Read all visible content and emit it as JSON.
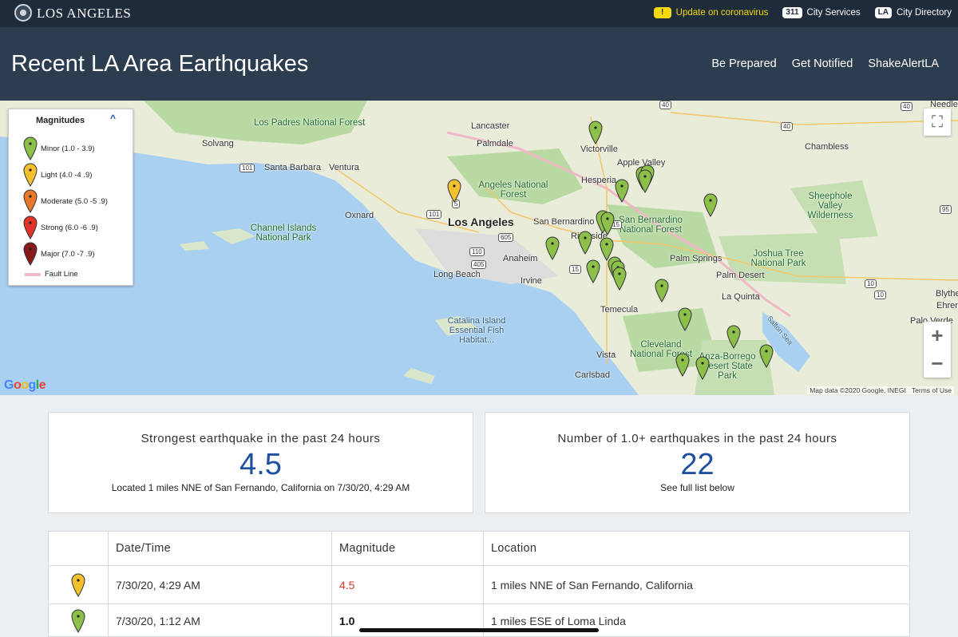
{
  "topbar": {
    "brand": "LOS ANGELES",
    "alert_badge": "!",
    "alert_text": "Update on coronavirus",
    "services_badge": "311",
    "services_label": "City Services",
    "directory_badge": "LA",
    "directory_label": "City Directory"
  },
  "header": {
    "title": "Recent LA Area Earthquakes",
    "nav": [
      "Be Prepared",
      "Get Notified",
      "ShakeAlertLA"
    ]
  },
  "map": {
    "legend": {
      "title": "Magnitudes",
      "toggle": "^",
      "items": [
        {
          "label": "Minor (1.0 - 3.9)",
          "color": "#8dc04a"
        },
        {
          "label": "Light (4.0 -4 .9)",
          "color": "#f3c12e"
        },
        {
          "label": "Moderate (5.0 -5 .9)",
          "color": "#e8782a"
        },
        {
          "label": "Strong (6.0 -6 .9)",
          "color": "#e0342a"
        },
        {
          "label": "Major (7.0 -7 .9)",
          "color": "#8a1a1a"
        }
      ],
      "fault_label": "Fault Line"
    },
    "places": [
      "Los Padres National Forest",
      "Lancaster",
      "Palmdale",
      "Victorville",
      "Apple Valley",
      "Hesperia",
      "Solvang",
      "Santa Barbara",
      "Ventura",
      "Oxnard",
      "Angeles National Forest",
      "Los Angeles",
      "San Bernardino",
      "Riverside",
      "San Bernardino National Forest",
      "Sheephole Valley Wilderness",
      "Channel Islands National Park",
      "Anaheim",
      "Irvine",
      "Long Beach",
      "Palm Springs",
      "Palm Desert",
      "Joshua Tree National Park",
      "La Quinta",
      "Temecula",
      "Catalina Island Essential Fish Habitat...",
      "Cleveland National Forest",
      "Vista",
      "Carlsbad",
      "Anza-Borrego Desert State Park",
      "Salton Sea",
      "Chambless",
      "Needles",
      "Blythe",
      "Ehrenb",
      "Palo Verde"
    ],
    "routes": [
      "101",
      "101",
      "5",
      "15",
      "40",
      "40",
      "95",
      "10",
      "10",
      "110",
      "405",
      "605",
      "15",
      "40"
    ],
    "google_logo": "Google",
    "attribution": "Map data ©2020 Google, INEGI",
    "terms": "Terms of Use",
    "zoom_in": "+",
    "zoom_out": "−",
    "fullscreen_icon": "⛶"
  },
  "summary": {
    "strongest_heading": "Strongest earthquake in the past 24 hours",
    "strongest_value": "4.5",
    "strongest_detail": "Located 1 miles NNE of San Fernando, California on 7/30/20, 4:29 AM",
    "count_heading": "Number of 1.0+ earthquakes in the past 24 hours",
    "count_value": "22",
    "count_detail": "See full list below"
  },
  "table": {
    "headers": [
      "Date/Time",
      "Magnitude",
      "Location"
    ],
    "rows": [
      {
        "datetime": "7/30/20, 4:29 AM",
        "magnitude": "4.5",
        "location": "1 miles NNE of San Fernando, California",
        "pin_color": "#f3c12e"
      },
      {
        "datetime": "7/30/20, 1:12 AM",
        "magnitude": "1.0",
        "location": "1 miles ESE of Loma Linda",
        "pin_color": "#8dc04a"
      }
    ]
  }
}
